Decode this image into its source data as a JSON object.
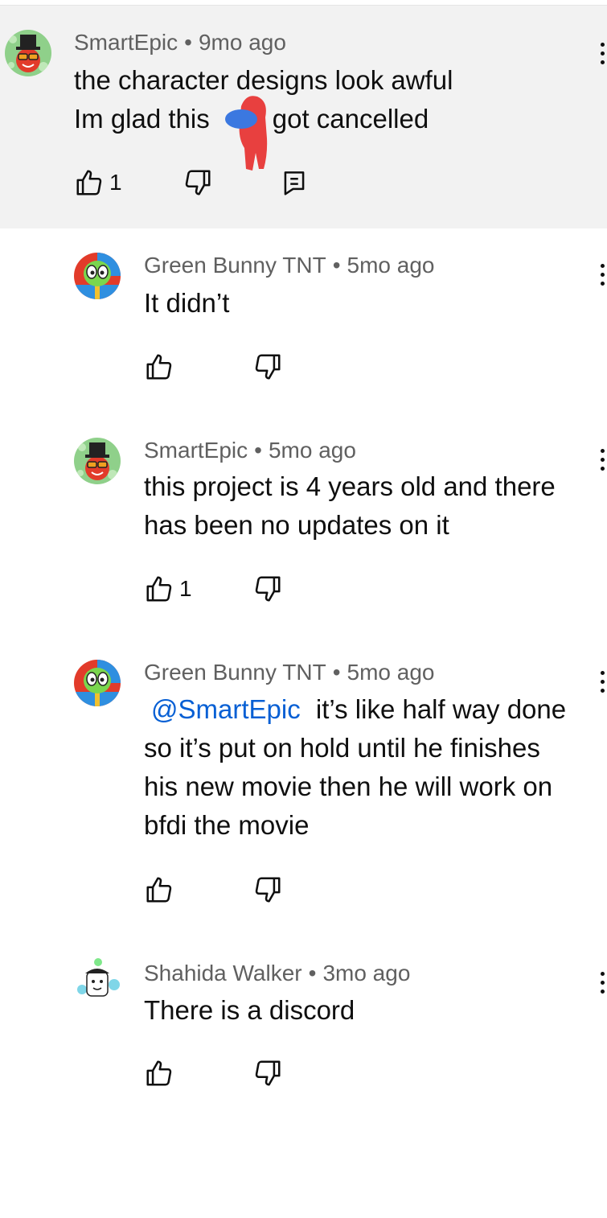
{
  "comments": [
    {
      "author": "SmartEpic",
      "time": "9mo ago",
      "lines": [
        "the character designs look awful",
        "Im glad this",
        "got cancelled"
      ],
      "likes": "1",
      "avatar_icon": "top-hat-avatar-icon"
    },
    {
      "author": "Green Bunny TNT",
      "time": "5mo ago",
      "text": "It didn’t",
      "avatar_icon": "green-bunny-avatar-icon"
    },
    {
      "author": "SmartEpic",
      "time": "5mo ago",
      "lines": [
        "this project is 4 years old and there",
        "has been no updates on it"
      ],
      "likes": "1",
      "avatar_icon": "top-hat-avatar-icon"
    },
    {
      "author": "Green Bunny TNT",
      "time": "5mo ago",
      "mention": "@SmartEpic",
      "lines": [
        "it’s like half way done",
        "so it’s put on hold until he finishes",
        "his new movie then he will work on",
        "bfdi the movie"
      ],
      "avatar_icon": "green-bunny-avatar-icon"
    },
    {
      "author": "Shahida Walker",
      "time": "3mo ago",
      "text": "There is a discord",
      "avatar_icon": "cartoon-avatar-icon"
    }
  ],
  "separator": "•",
  "colors": {
    "highlight_bg": "#f2f2f2",
    "meta_text": "#606060",
    "mention": "#065fd4",
    "redaction_red": "#e8403f",
    "redaction_blue": "#3b78e0"
  }
}
